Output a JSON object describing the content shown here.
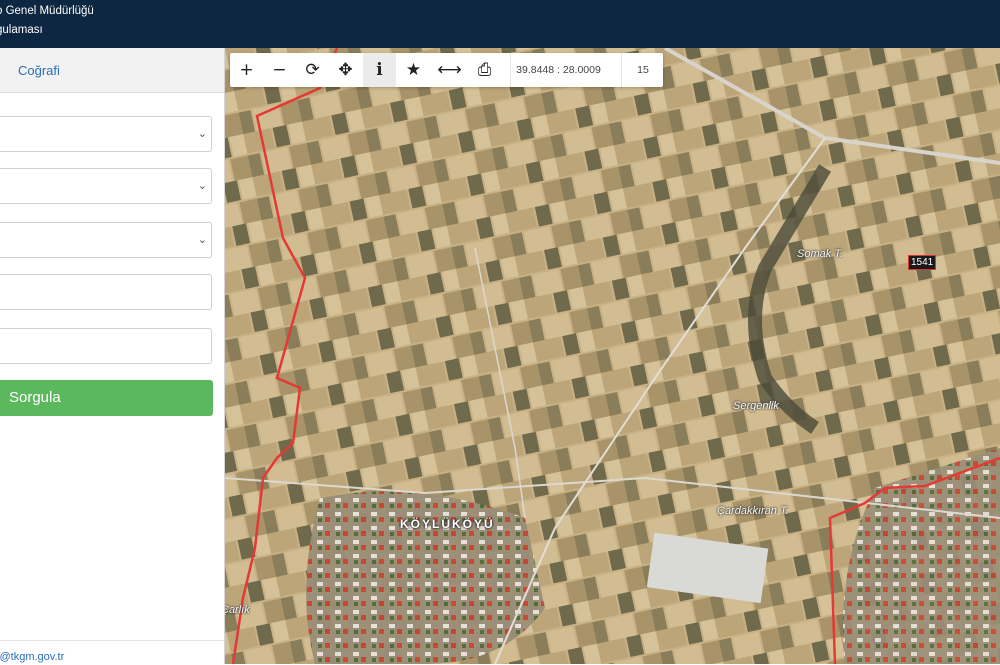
{
  "header": {
    "title": "o Genel Müdürlüğü",
    "subtitle": "gulaması",
    "background": "#0d2642"
  },
  "sidebar": {
    "tab_label": "Coğrafi",
    "select_fields": [
      {
        "value": "",
        "chevron": "chevron-down-icon"
      },
      {
        "value": "",
        "chevron": "chevron-down-icon"
      },
      {
        "value": "",
        "chevron": "chevron-down-icon"
      }
    ],
    "text_fields": [
      {
        "value": ""
      },
      {
        "value": ""
      }
    ],
    "query_button_label": "Sorgula",
    "query_button_color": "#5cb85c",
    "footer_email": "s@tkgm.gov.tr"
  },
  "toolbar": {
    "tools": [
      {
        "name": "zoom-in",
        "glyph": "+"
      },
      {
        "name": "zoom-out",
        "glyph": "−"
      },
      {
        "name": "refresh",
        "glyph": "⟳"
      },
      {
        "name": "pan",
        "glyph": "✥"
      },
      {
        "name": "info",
        "glyph": "i",
        "active": true
      },
      {
        "name": "favorite",
        "glyph": "★"
      },
      {
        "name": "measure",
        "glyph": "⟷"
      },
      {
        "name": "print",
        "glyph": "⎙"
      }
    ],
    "coordinates": "39.8448 : 28.0009",
    "zoom_level": "15"
  },
  "map": {
    "village_label": "KÖYLÜKÖYÜ",
    "place_labels": [
      "Somak T.",
      "Sergenlik",
      "Çardakkıran T.",
      "Çarlık"
    ],
    "parcel_label": "1541",
    "boundary_color": "#e53935"
  }
}
